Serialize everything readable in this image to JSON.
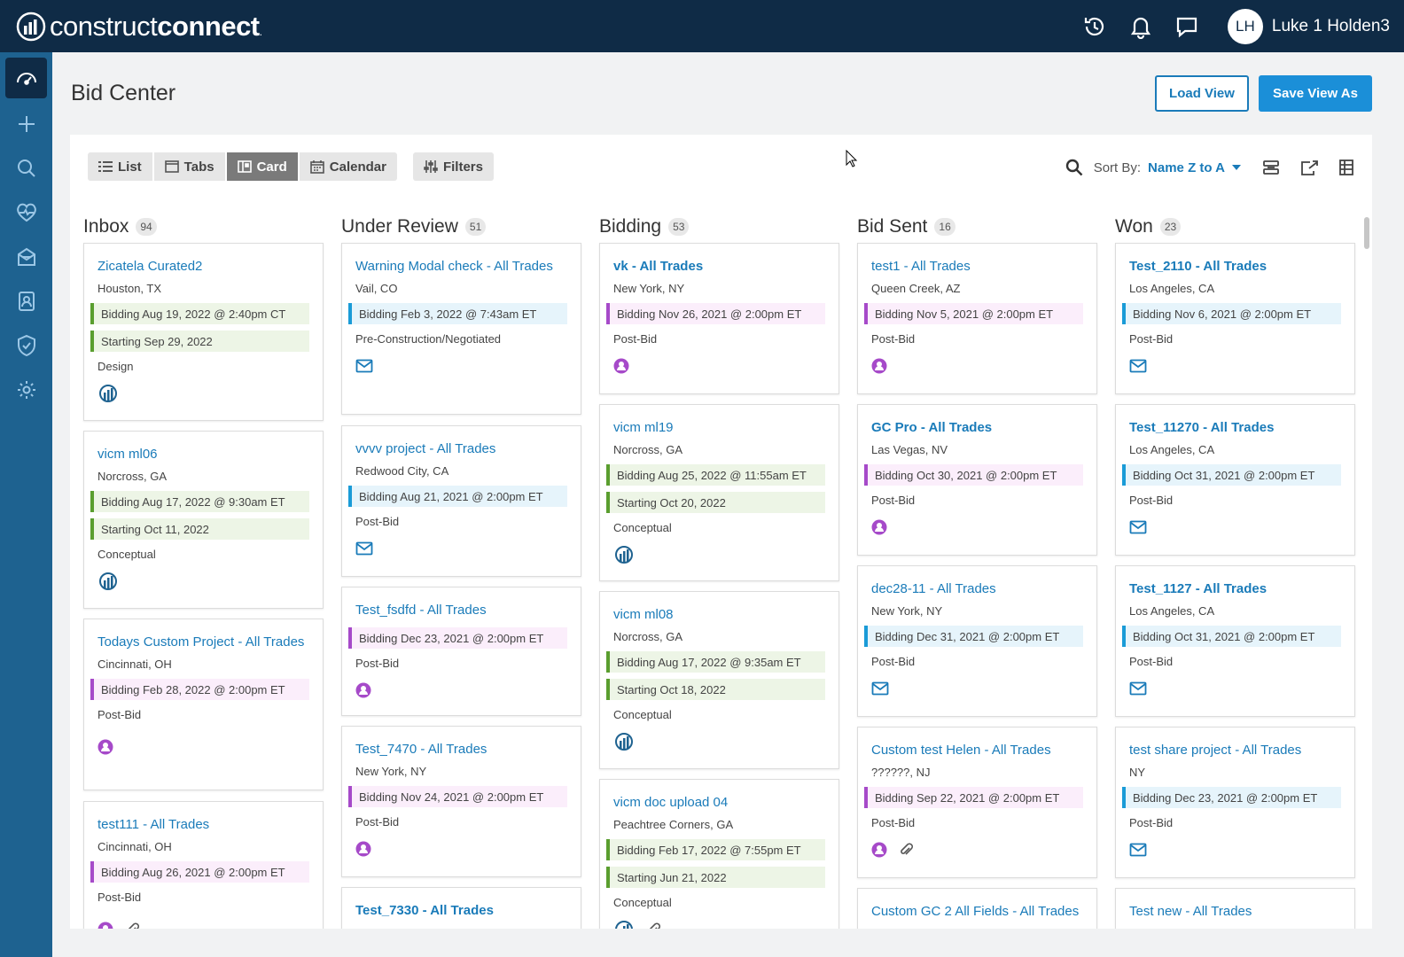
{
  "app": {
    "logo_light": "construct",
    "logo_bold": "connect",
    "logo_mark": "."
  },
  "user": {
    "initials": "LH",
    "name": "Luke 1 Holden3"
  },
  "top_icons": [
    "history-icon",
    "bell-icon",
    "chat-icon"
  ],
  "sidebar": [
    "dashboard-icon",
    "plus-icon",
    "search-icon",
    "heart-pulse-icon",
    "inbox-icon",
    "contacts-icon",
    "shield-icon",
    "gear-icon"
  ],
  "page": {
    "title": "Bid Center",
    "load_view": "Load View",
    "save_view_as": "Save View As"
  },
  "views": {
    "list": "List",
    "tabs": "Tabs",
    "card": "Card",
    "calendar": "Calendar",
    "filters": "Filters",
    "active": "Card"
  },
  "sort": {
    "label": "Sort By:",
    "value": "Name Z to A"
  },
  "columns": [
    {
      "title": "Inbox",
      "count": "94",
      "cards": [
        {
          "title": "Zicatela Curated2",
          "bold": false,
          "location": "Houston, TX",
          "bars": [
            {
              "text": "Bidding Aug 19, 2022 @ 2:40pm CT",
              "color": "green"
            },
            {
              "text": "Starting Sep 29, 2022",
              "color": "green"
            }
          ],
          "stage": "Design",
          "icons": [
            "construct-connect-icon"
          ]
        },
        {
          "title": "vicm ml06",
          "bold": false,
          "location": "Norcross, GA",
          "bars": [
            {
              "text": "Bidding Aug 17, 2022 @ 9:30am ET",
              "color": "green"
            },
            {
              "text": "Starting Oct 11, 2022",
              "color": "green"
            }
          ],
          "stage": "Conceptual",
          "icons": [
            "construct-connect-icon"
          ]
        },
        {
          "title": "Todays Custom Project - All Trades",
          "bold": false,
          "location": "Cincinnati, OH",
          "bars": [
            {
              "text": "Bidding Feb 28, 2022 @ 2:00pm ET",
              "color": "pink"
            }
          ],
          "stage": "Post-Bid",
          "icons": [
            "user-icon"
          ]
        },
        {
          "title": "test111 - All Trades",
          "bold": false,
          "location": "Cincinnati, OH",
          "bars": [
            {
              "text": "Bidding Aug 26, 2021 @ 2:00pm ET",
              "color": "pink"
            }
          ],
          "stage": "Post-Bid",
          "icons": [
            "user-icon",
            "paperclip-icon"
          ]
        }
      ]
    },
    {
      "title": "Under Review",
      "count": "51",
      "cards": [
        {
          "title": "Warning Modal check - All Trades",
          "bold": false,
          "location": "Vail, CO",
          "bars": [
            {
              "text": "Bidding Feb 3, 2022 @ 7:43am ET",
              "color": "blue"
            }
          ],
          "stage": "Pre-Construction/Negotiated",
          "icons": [
            "mail-icon"
          ]
        },
        {
          "title": "vvvv project - All Trades",
          "bold": false,
          "location": "Redwood City, CA",
          "bars": [
            {
              "text": "Bidding Aug 21, 2021 @ 2:00pm ET",
              "color": "blue"
            }
          ],
          "stage": "Post-Bid",
          "icons": [
            "mail-icon"
          ]
        },
        {
          "title": "Test_fsdfd - All Trades",
          "bold": false,
          "location": "",
          "bars": [
            {
              "text": "Bidding Dec 23, 2021 @ 2:00pm ET",
              "color": "pink"
            }
          ],
          "stage": "Post-Bid",
          "icons": [
            "user-icon"
          ]
        },
        {
          "title": "Test_7470 - All Trades",
          "bold": false,
          "location": "New York, NY",
          "bars": [
            {
              "text": "Bidding Nov 24, 2021 @ 2:00pm ET",
              "color": "pink"
            }
          ],
          "stage": "Post-Bid",
          "icons": [
            "user-icon"
          ]
        },
        {
          "title": "Test_7330 - All Trades",
          "bold": true,
          "location": "",
          "bars": [],
          "stage": "",
          "icons": []
        }
      ]
    },
    {
      "title": "Bidding",
      "count": "53",
      "cards": [
        {
          "title": "vk - All Trades",
          "bold": true,
          "location": "New York, NY",
          "bars": [
            {
              "text": "Bidding Nov 26, 2021 @ 2:00pm ET",
              "color": "pink"
            }
          ],
          "stage": "Post-Bid",
          "icons": [
            "user-icon"
          ]
        },
        {
          "title": "vicm ml19",
          "bold": false,
          "location": "Norcross, GA",
          "bars": [
            {
              "text": "Bidding Aug 25, 2022 @ 11:55am ET",
              "color": "green"
            },
            {
              "text": "Starting Oct 20, 2022",
              "color": "green"
            }
          ],
          "stage": "Conceptual",
          "icons": [
            "construct-connect-icon"
          ]
        },
        {
          "title": "vicm ml08",
          "bold": false,
          "location": "Norcross, GA",
          "bars": [
            {
              "text": "Bidding Aug 17, 2022 @ 9:35am ET",
              "color": "green"
            },
            {
              "text": "Starting Oct 18, 2022",
              "color": "green"
            }
          ],
          "stage": "Conceptual",
          "icons": [
            "construct-connect-icon"
          ]
        },
        {
          "title": "vicm doc upload 04",
          "bold": false,
          "location": "Peachtree Corners, GA",
          "bars": [
            {
              "text": "Bidding Feb 17, 2022 @ 7:55pm ET",
              "color": "green"
            },
            {
              "text": "Starting Jun 21, 2022",
              "color": "green"
            }
          ],
          "stage": "Conceptual",
          "icons": [
            "construct-connect-icon",
            "paperclip-icon"
          ]
        }
      ]
    },
    {
      "title": "Bid Sent",
      "count": "16",
      "cards": [
        {
          "title": "test1 - All Trades",
          "bold": false,
          "location": "Queen Creek, AZ",
          "bars": [
            {
              "text": "Bidding Nov 5, 2021 @ 2:00pm ET",
              "color": "pink"
            }
          ],
          "stage": "Post-Bid",
          "icons": [
            "user-icon"
          ]
        },
        {
          "title": "GC Pro - All Trades",
          "bold": true,
          "location": "Las Vegas, NV",
          "bars": [
            {
              "text": "Bidding Oct 30, 2021 @ 2:00pm ET",
              "color": "pink"
            }
          ],
          "stage": "Post-Bid",
          "icons": [
            "user-icon"
          ]
        },
        {
          "title": "dec28-11 - All Trades",
          "bold": false,
          "location": "New York, NY",
          "bars": [
            {
              "text": "Bidding Dec 31, 2021 @ 2:00pm ET",
              "color": "blue"
            }
          ],
          "stage": "Post-Bid",
          "icons": [
            "mail-icon"
          ]
        },
        {
          "title": "Custom test Helen - All Trades",
          "bold": false,
          "location": "??????, NJ",
          "bars": [
            {
              "text": "Bidding Sep 22, 2021 @ 2:00pm ET",
              "color": "pink"
            }
          ],
          "stage": "Post-Bid",
          "icons": [
            "user-icon",
            "paperclip-icon"
          ]
        },
        {
          "title": "Custom GC 2 All Fields - All Trades",
          "bold": false,
          "location": "",
          "bars": [],
          "stage": "",
          "icons": []
        }
      ]
    },
    {
      "title": "Won",
      "count": "23",
      "cards": [
        {
          "title": "Test_2110 - All Trades",
          "bold": true,
          "location": "Los Angeles, CA",
          "bars": [
            {
              "text": "Bidding Nov 6, 2021 @ 2:00pm ET",
              "color": "blue"
            }
          ],
          "stage": "Post-Bid",
          "icons": [
            "mail-icon"
          ]
        },
        {
          "title": "Test_11270 - All Trades",
          "bold": true,
          "location": "Los Angeles, CA",
          "bars": [
            {
              "text": "Bidding Oct 31, 2021 @ 2:00pm ET",
              "color": "blue"
            }
          ],
          "stage": "Post-Bid",
          "icons": [
            "mail-icon"
          ]
        },
        {
          "title": "Test_1127 - All Trades",
          "bold": true,
          "location": "Los Angeles, CA",
          "bars": [
            {
              "text": "Bidding Oct 31, 2021 @ 2:00pm ET",
              "color": "blue"
            }
          ],
          "stage": "Post-Bid",
          "icons": [
            "mail-icon"
          ]
        },
        {
          "title": "test share project - All Trades",
          "bold": false,
          "location": "NY",
          "bars": [
            {
              "text": "Bidding Dec 23, 2021 @ 2:00pm ET",
              "color": "blue"
            }
          ],
          "stage": "Post-Bid",
          "icons": [
            "mail-icon"
          ]
        },
        {
          "title": "Test new - All Trades",
          "bold": false,
          "location": "",
          "bars": [],
          "stage": "",
          "icons": []
        }
      ]
    }
  ],
  "colors": {
    "navy": "#0f2b46",
    "sidebar": "#1e6290",
    "link": "#1a7bb9",
    "primary": "#1b8fd8",
    "green": "#5a9e2f",
    "pink": "#a64ac9",
    "blue": "#1a9bd7"
  }
}
